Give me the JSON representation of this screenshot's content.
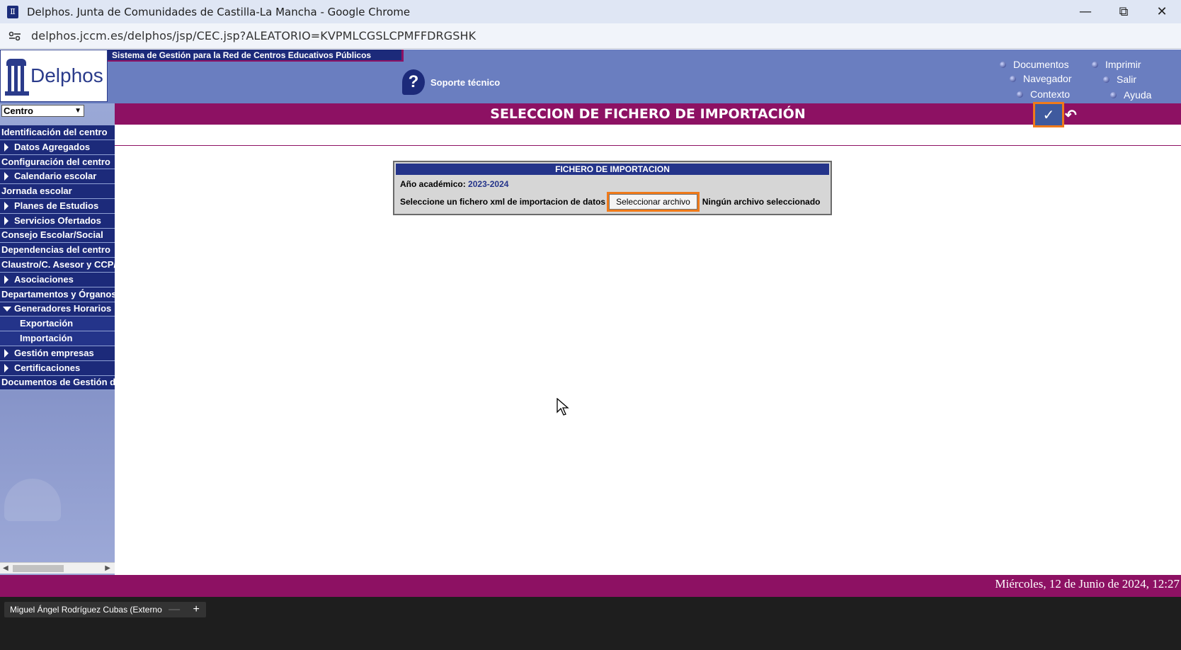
{
  "browser": {
    "window_title": "Delphos. Junta de Comunidades de Castilla-La Mancha - Google Chrome",
    "url": "delphos.jccm.es/delphos/jsp/CEC.jsp?ALEATORIO=KVPMLCGSLCPMFFDRGSHK",
    "minimize": "—",
    "restore": "⧉",
    "close": "✕"
  },
  "header": {
    "logo_text": "Delphos",
    "system_banner": "Sistema de Gestión para la Red de Centros Educativos Públicos",
    "support_label": "Soporte técnico",
    "links": {
      "documentos": "Documentos",
      "navegador": "Navegador",
      "contexto": "Contexto",
      "imprimir": "Imprimir",
      "salir": "Salir",
      "ayuda": "Ayuda"
    }
  },
  "sidebar": {
    "select_value": "Centro",
    "items": [
      {
        "label": "Identificación del centro"
      },
      {
        "label": "Datos Agregados"
      },
      {
        "label": "Configuración del centro"
      },
      {
        "label": "Calendario escolar"
      },
      {
        "label": "Jornada escolar"
      },
      {
        "label": "Planes de Estudios"
      },
      {
        "label": "Servicios Ofertados"
      },
      {
        "label": "Consejo Escolar/Social"
      },
      {
        "label": "Dependencias del centro"
      },
      {
        "label": "Claustro/C. Asesor y CCP/C"
      },
      {
        "label": "Asociaciones"
      },
      {
        "label": "Departamentos y Órganos c"
      },
      {
        "label": "Generadores Horarios"
      },
      {
        "label": "Exportación"
      },
      {
        "label": "Importación"
      },
      {
        "label": "Gestión empresas"
      },
      {
        "label": "Certificaciones"
      },
      {
        "label": "Documentos de Gestión de"
      }
    ]
  },
  "page": {
    "title": "SELECCION DE FICHERO DE IMPORTACIÓN",
    "accept_icon": "✓",
    "undo_icon": "↶"
  },
  "panel": {
    "header": "FICHERO DE IMPORTACION",
    "year_label": "Año académico:",
    "year_value": "2023-2024",
    "file_label": "Seleccione un fichero xml de importacion de datos",
    "file_button": "Seleccionar archivo",
    "file_status": "Ningún archivo seleccionado"
  },
  "footer": {
    "date": "Miércoles, 12 de Junio de 2024, 12:27"
  },
  "taskbar": {
    "user": "Miguel Ángel Rodríguez Cubas (Externo)",
    "zoom_out": "—",
    "zoom_in": "+"
  }
}
